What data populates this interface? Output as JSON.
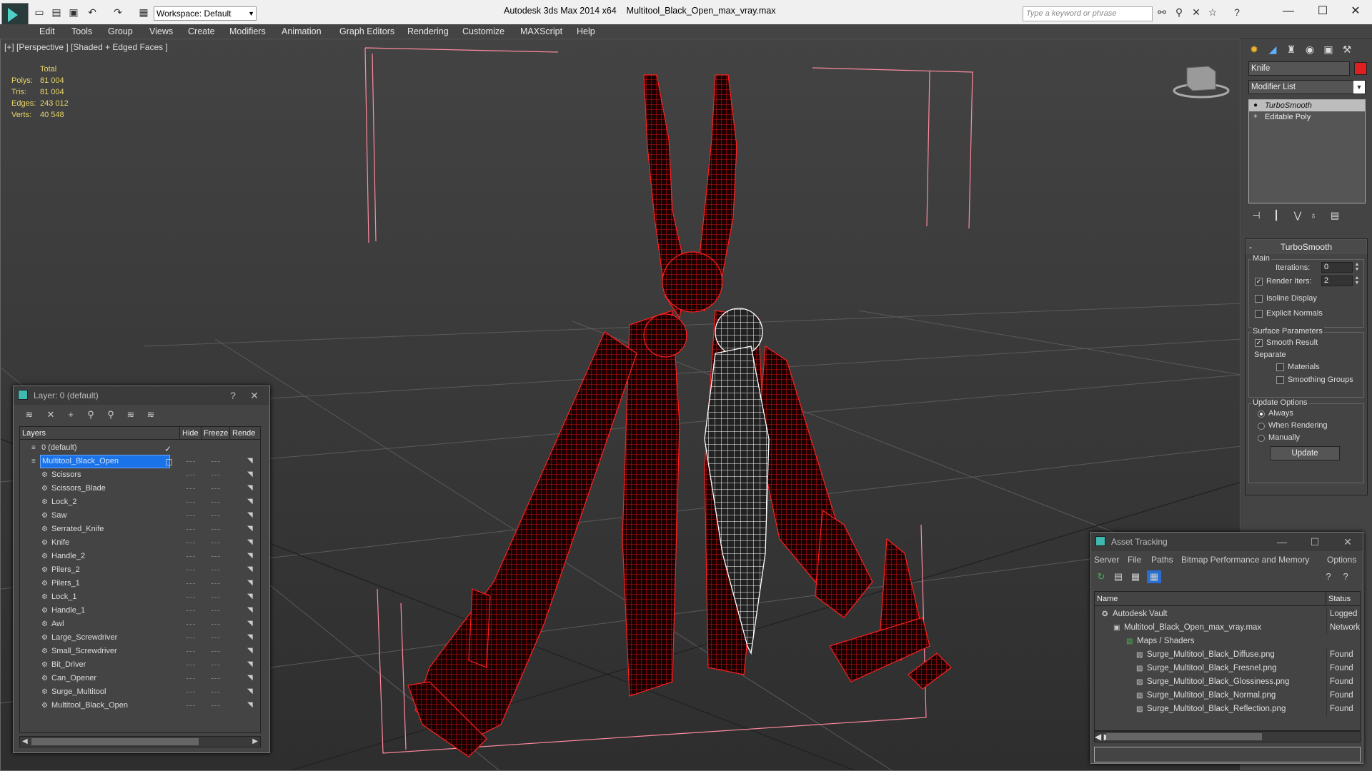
{
  "titlebar": {
    "workspace": "Workspace: Default",
    "app_title": "Autodesk 3ds Max  2014 x64",
    "file_title": "Multitool_Black_Open_max_vray.max",
    "search_placeholder": "Type a keyword or phrase"
  },
  "menubar": [
    "Edit",
    "Tools",
    "Group",
    "Views",
    "Create",
    "Modifiers",
    "Animation",
    "Graph Editors",
    "Rendering",
    "Customize",
    "MAXScript",
    "Help"
  ],
  "viewport": {
    "label": "[+] [Perspective ] [Shaded + Edged Faces ]",
    "stats": {
      "header": "Total",
      "rows": [
        {
          "label": "Polys:",
          "value": "81 004"
        },
        {
          "label": "Tris:",
          "value": "81 004"
        },
        {
          "label": "Edges:",
          "value": "243 012"
        },
        {
          "label": "Verts:",
          "value": "40 548"
        }
      ]
    },
    "colors": {
      "wire": "#c81010",
      "selected_wire": "#ffffff",
      "gizmo": "#ff8aa0"
    }
  },
  "command_panel": {
    "object_name": "Knife",
    "object_color": "#e02020",
    "modifier_list": "Modifier List",
    "stack": [
      "TurboSmooth",
      "Editable Poly"
    ],
    "turbosmooth": {
      "title": "TurboSmooth",
      "main_label": "Main",
      "iterations_label": "Iterations:",
      "iterations_value": "0",
      "render_iters_label": "Render Iters:",
      "render_iters_value": "2",
      "isoline_label": "Isoline Display",
      "explicit_normals_label": "Explicit Normals",
      "surface_label": "Surface Parameters",
      "smooth_result_label": "Smooth Result",
      "separate_label": "Separate",
      "materials_label": "Materials",
      "smoothing_groups_label": "Smoothing Groups",
      "update_options_label": "Update Options",
      "always_label": "Always",
      "when_rendering_label": "When Rendering",
      "manually_label": "Manually",
      "update_button": "Update"
    }
  },
  "layer_window": {
    "title": "Layer: 0 (default)",
    "help": "?",
    "columns": [
      "Layers",
      "Hide",
      "Freeze",
      "Rende"
    ],
    "rows": [
      {
        "name": "0 (default)",
        "level": 0
      },
      {
        "name": "Multitool_Black_Open",
        "level": 0
      },
      {
        "name": "Scissors",
        "level": 1
      },
      {
        "name": "Scissors_Blade",
        "level": 1
      },
      {
        "name": "Lock_2",
        "level": 1
      },
      {
        "name": "Saw",
        "level": 1
      },
      {
        "name": "Serrated_Knife",
        "level": 1
      },
      {
        "name": "Knife",
        "level": 1
      },
      {
        "name": "Handle_2",
        "level": 1
      },
      {
        "name": "Pilers_2",
        "level": 1
      },
      {
        "name": "Pilers_1",
        "level": 1
      },
      {
        "name": "Lock_1",
        "level": 1
      },
      {
        "name": "Handle_1",
        "level": 1
      },
      {
        "name": "Awl",
        "level": 1
      },
      {
        "name": "Large_Screwdriver",
        "level": 1
      },
      {
        "name": "Small_Screwdriver",
        "level": 1
      },
      {
        "name": "Bit_Driver",
        "level": 1
      },
      {
        "name": "Can_Opener",
        "level": 1
      },
      {
        "name": "Surge_Multitool",
        "level": 1
      },
      {
        "name": "Multitool_Black_Open",
        "level": 1
      }
    ]
  },
  "asset_window": {
    "title": "Asset Tracking",
    "menu": [
      "Server",
      "File",
      "Paths",
      "Bitmap Performance and Memory",
      "Options"
    ],
    "columns": [
      "Name",
      "Status"
    ],
    "rows": [
      {
        "name": "Autodesk Vault",
        "status": "Logged O"
      },
      {
        "name": "Multitool_Black_Open_max_vray.max",
        "status": "Network"
      },
      {
        "name": "Maps / Shaders",
        "status": ""
      },
      {
        "name": "Surge_Multitool_Black_Diffuse.png",
        "status": "Found"
      },
      {
        "name": "Surge_Multitool_Black_Fresnel.png",
        "status": "Found"
      },
      {
        "name": "Surge_Multitool_Black_Glossiness.png",
        "status": "Found"
      },
      {
        "name": "Surge_Multitool_Black_Normal.png",
        "status": "Found"
      },
      {
        "name": "Surge_Multitool_Black_Reflection.png",
        "status": "Found"
      }
    ]
  }
}
